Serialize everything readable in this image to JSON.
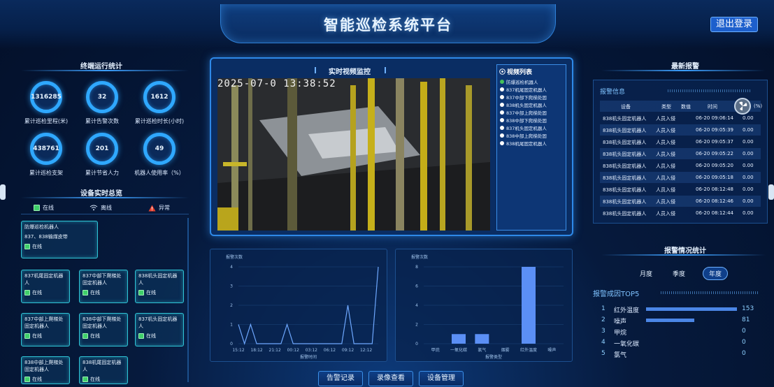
{
  "header": {
    "title": "智能巡检系统平台",
    "logout_label": "退出登录"
  },
  "terminal_stats": {
    "title": "终端运行统计",
    "items": [
      {
        "value": "1316285",
        "label": "累计巡检里程(米)"
      },
      {
        "value": "32",
        "label": "累计告警次数"
      },
      {
        "value": "1612",
        "label": "累计巡检时长(小时)"
      },
      {
        "value": "438761",
        "label": "累计巡检支架"
      },
      {
        "value": "201",
        "label": "累计节省人力"
      },
      {
        "value": "49",
        "label": "机器人使用率（%）"
      }
    ]
  },
  "device_overview": {
    "title": "设备实时总览",
    "legend": {
      "online": "在线",
      "offline": "离线",
      "abnormal": "异常"
    },
    "cards": [
      {
        "name": "防爆巡检机器人",
        "sub": "837、838输煤皮带",
        "status": "在线"
      },
      {
        "name": "837机尾固定机器人",
        "status": "在线"
      },
      {
        "name": "837中部下爬梯处固定机器人",
        "status": "在线"
      },
      {
        "name": "838机头固定机器人",
        "status": "在线"
      },
      {
        "name": "837中部上爬梯处固定机器人",
        "status": "在线"
      },
      {
        "name": "838中部下爬梯处固定机器人",
        "status": "在线"
      },
      {
        "name": "837机头固定机器人",
        "status": "在线"
      },
      {
        "name": "838中部上爬梯处固定机器人",
        "status": "在线"
      },
      {
        "name": "838机尾固定机器人",
        "status": "在线"
      }
    ]
  },
  "video": {
    "title": "实时视频监控",
    "timestamp": "2025-07-0  13:38:52",
    "list_title": "视频列表",
    "list": [
      {
        "name": "防爆巡检机器人",
        "active": true
      },
      {
        "name": "837机尾固定机器人",
        "active": false
      },
      {
        "name": "837中部下爬梯处固",
        "active": false
      },
      {
        "name": "838机头固定机器人",
        "active": false
      },
      {
        "name": "837中部上爬梯处固",
        "active": false
      },
      {
        "name": "838中部下爬梯处固",
        "active": false
      },
      {
        "name": "837机头固定机器人",
        "active": false
      },
      {
        "name": "838中部上爬梯处固",
        "active": false
      },
      {
        "name": "838机尾固定机器人",
        "active": false
      }
    ]
  },
  "chart_data": [
    {
      "type": "line",
      "ylabel": "报警次数",
      "xlabel": "报警时间",
      "x": [
        "15:12",
        "16:12",
        "17:12",
        "18:12",
        "19:12",
        "20:12",
        "21:12",
        "22:12",
        "23:12",
        "00:12",
        "01:12",
        "02:12",
        "03:12",
        "04:12",
        "05:12",
        "06:12",
        "07:12",
        "08:12",
        "09:12",
        "10:12",
        "11:12",
        "12:12",
        "13:12",
        "14:12"
      ],
      "xticks": [
        "15:12",
        "18:12",
        "21:12",
        "00:12",
        "03:12",
        "06:12",
        "09:12",
        "12:12"
      ],
      "values": [
        1,
        0,
        1,
        0,
        0,
        0,
        0,
        0,
        1,
        0,
        0,
        0,
        0,
        0,
        0,
        0,
        0,
        0,
        2,
        0,
        0,
        0,
        0,
        4
      ],
      "ylim": [
        0,
        4
      ],
      "yticks": [
        0,
        1,
        2,
        3,
        4
      ],
      "color": "#6ea8ff"
    },
    {
      "type": "bar",
      "ylabel": "报警次数",
      "xlabel": "报警类型",
      "categories": [
        "甲烷",
        "一氧化碳",
        "氯气",
        "烟雾",
        "红外温度",
        "噪声"
      ],
      "values": [
        0,
        1,
        1,
        0,
        8,
        0
      ],
      "ylim": [
        0,
        8
      ],
      "yticks": [
        0,
        2,
        4,
        6,
        8
      ],
      "color": "#5b8ff5"
    }
  ],
  "alarms": {
    "title": "最新报警",
    "info_label": "报警信息",
    "columns": [
      "设备",
      "类型",
      "数值",
      "时间",
      "(%)"
    ],
    "rows": [
      {
        "device": "838机头固定机器人",
        "type": "人员入侵",
        "time": "06-20 09:06:14",
        "value": "0.00"
      },
      {
        "device": "838机头固定机器人",
        "type": "人员入侵",
        "time": "06-20 09:05:39",
        "value": "0.00"
      },
      {
        "device": "838机头固定机器人",
        "type": "人员入侵",
        "time": "06-20 09:05:37",
        "value": "0.00"
      },
      {
        "device": "838机头固定机器人",
        "type": "人员入侵",
        "time": "06-20 09:05:22",
        "value": "0.00"
      },
      {
        "device": "838机头固定机器人",
        "type": "人员入侵",
        "time": "06-20 09:05:20",
        "value": "0.00"
      },
      {
        "device": "838机头固定机器人",
        "type": "人员入侵",
        "time": "06-20 09:05:18",
        "value": "0.00"
      },
      {
        "device": "838机头固定机器人",
        "type": "人员入侵",
        "time": "06-20 08:12:48",
        "value": "0.00"
      },
      {
        "device": "838机头固定机器人",
        "type": "人员入侵",
        "time": "06-20 08:12:46",
        "value": "0.00"
      },
      {
        "device": "838机头固定机器人",
        "type": "人员入侵",
        "time": "06-20 08:12:44",
        "value": "0.00"
      }
    ]
  },
  "alarm_stats": {
    "title": "报警情况统计",
    "tabs": [
      "月度",
      "季度",
      "年度"
    ],
    "active_tab": 2,
    "top5_title": "报警成因TOP5",
    "top5": [
      {
        "rank": "1",
        "name": "红外温度",
        "value": 153
      },
      {
        "rank": "2",
        "name": "噪声",
        "value": 81
      },
      {
        "rank": "3",
        "name": "甲烷",
        "value": 0
      },
      {
        "rank": "4",
        "name": "一氧化碳",
        "value": 0
      },
      {
        "rank": "5",
        "name": "氯气",
        "value": 0
      }
    ]
  },
  "bottom_nav": [
    "告警记录",
    "录像查看",
    "设备管理"
  ]
}
